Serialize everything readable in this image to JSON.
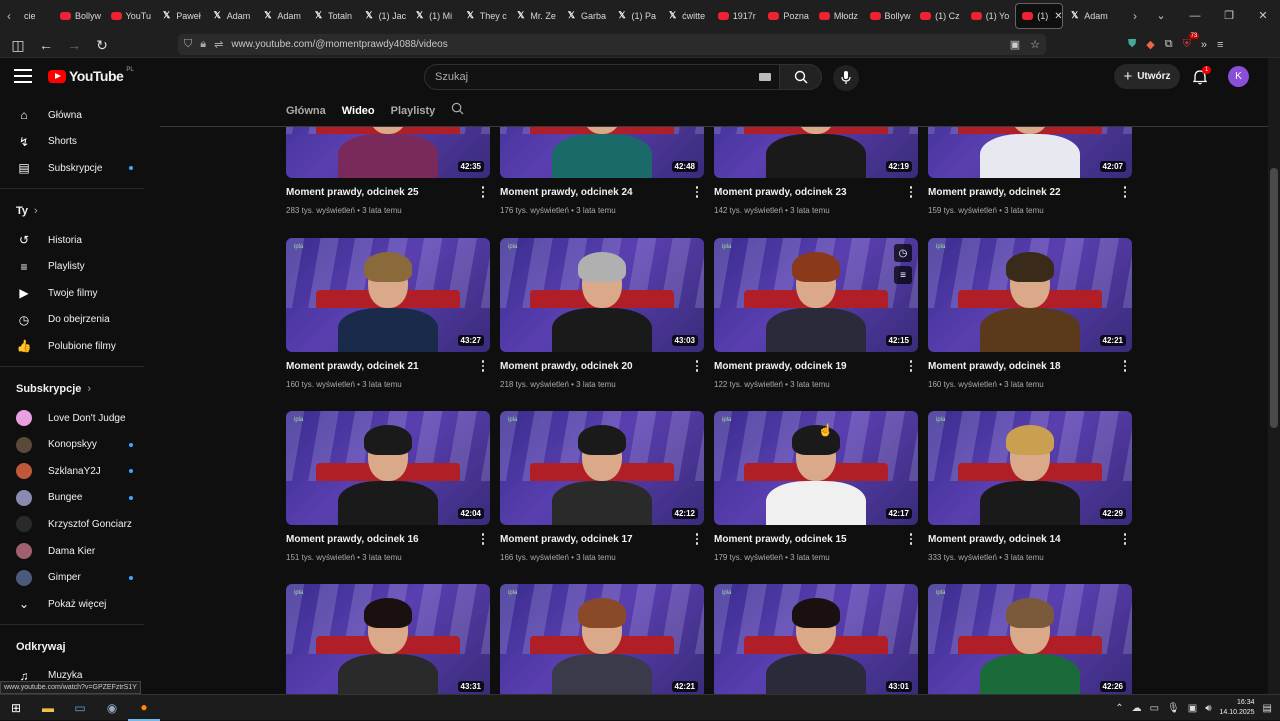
{
  "browser": {
    "tabs": [
      {
        "icon": "youtube",
        "label": "Bollyw"
      },
      {
        "icon": "youtube",
        "label": "YouTu"
      },
      {
        "icon": "x",
        "label": "Paweł"
      },
      {
        "icon": "x",
        "label": "Adam"
      },
      {
        "icon": "x",
        "label": "Adam"
      },
      {
        "icon": "x",
        "label": "Totaln"
      },
      {
        "icon": "x",
        "label": "(1) Jac"
      },
      {
        "icon": "x",
        "label": "(1) Mi"
      },
      {
        "icon": "x",
        "label": "They c"
      },
      {
        "icon": "x",
        "label": "Mr. Ze"
      },
      {
        "icon": "x",
        "label": "Garba"
      },
      {
        "icon": "x",
        "label": "(1) Pa"
      },
      {
        "icon": "x",
        "label": "ćwitte"
      },
      {
        "icon": "youtube",
        "label": "1917r"
      },
      {
        "icon": "youtube",
        "label": "Pozna"
      },
      {
        "icon": "youtube",
        "label": "Młodz"
      },
      {
        "icon": "youtube",
        "label": "Bollyw"
      },
      {
        "icon": "youtube",
        "label": "(1) Cz"
      },
      {
        "icon": "youtube",
        "label": "(1) Yo"
      },
      {
        "icon": "youtube",
        "label": "(1)",
        "active": true
      },
      {
        "icon": "x",
        "label": "Adam"
      }
    ],
    "first_tab_partial": "cie",
    "url": "www.youtube.com/@momentprawdy4088/videos",
    "ext_badge": "73",
    "status_url": "www.youtube.com/watch?v=GPZEFztrS1Y"
  },
  "youtube": {
    "logo_text": "YouTube",
    "logo_country": "PL",
    "search_placeholder": "Szukaj",
    "create_label": "Utwórz",
    "notif_count": "1",
    "avatar_letter": "K"
  },
  "sidebar": {
    "main": [
      {
        "label": "Główna",
        "icon": "home-icon",
        "glyph": "⌂"
      },
      {
        "label": "Shorts",
        "icon": "shorts-icon",
        "glyph": "↯"
      },
      {
        "label": "Subskrypcje",
        "icon": "subscriptions-icon",
        "glyph": "▤",
        "dot": true
      }
    ],
    "you_header": "Ty",
    "you": [
      {
        "label": "Historia",
        "icon": "history-icon",
        "glyph": "↺"
      },
      {
        "label": "Playlisty",
        "icon": "playlists-icon",
        "glyph": "≡"
      },
      {
        "label": "Twoje filmy",
        "icon": "your-videos-icon",
        "glyph": "▶"
      },
      {
        "label": "Do obejrzenia",
        "icon": "watch-later-icon",
        "glyph": "◷"
      },
      {
        "label": "Polubione filmy",
        "icon": "liked-icon",
        "glyph": "👍"
      }
    ],
    "subs_header": "Subskrypcje",
    "subs": [
      {
        "label": "Love Don't Judge",
        "color": "#e8a0e0",
        "dot": false
      },
      {
        "label": "Konopskyy",
        "color": "#5a4a3a",
        "dot": true
      },
      {
        "label": "SzklanaY2J",
        "color": "#c0583a",
        "dot": true
      },
      {
        "label": "Bungee",
        "color": "#8a8ab0",
        "dot": true
      },
      {
        "label": "Krzysztof Gonciarz",
        "color": "#2a2a2a",
        "dot": false
      },
      {
        "label": "Dama Kier",
        "color": "#a06070",
        "dot": false
      },
      {
        "label": "Gimper",
        "color": "#4a5a7a",
        "dot": true
      }
    ],
    "show_more": "Pokaż więcej",
    "explore_header": "Odkrywaj",
    "explore": [
      {
        "label": "Muzyka",
        "icon": "music-icon",
        "glyph": "♫"
      }
    ]
  },
  "channel_tabs": [
    "Główna",
    "Wideo",
    "Playlisty"
  ],
  "active_tab": "Wideo",
  "videos": [
    {
      "title": "Moment prawdy, odcinek 25",
      "meta": "283 tys. wyświetleń • 3 lata temu",
      "duration": "42:35",
      "shirt": "#7a2a5a",
      "hair": "#3a2a1a"
    },
    {
      "title": "Moment prawdy, odcinek 24",
      "meta": "176 tys. wyświetleń • 3 lata temu",
      "duration": "42:48",
      "shirt": "#1a6a6a",
      "hair": "#2a1a10"
    },
    {
      "title": "Moment prawdy, odcinek 23",
      "meta": "142 tys. wyświetleń • 3 lata temu",
      "duration": "42:19",
      "shirt": "#1a1a1a",
      "hair": "#1a1a1a"
    },
    {
      "title": "Moment prawdy, odcinek 22",
      "meta": "159 tys. wyświetleń • 3 lata temu",
      "duration": "42:07",
      "shirt": "#e8e8f0",
      "hair": "#3a2a1a"
    },
    {
      "title": "Moment prawdy, odcinek 21",
      "meta": "160 tys. wyświetleń • 3 lata temu",
      "duration": "43:27",
      "shirt": "#1a2a4a",
      "hair": "#8a6a3a"
    },
    {
      "title": "Moment prawdy, odcinek 20",
      "meta": "218 tys. wyświetleń • 3 lata temu",
      "duration": "43:03",
      "shirt": "#1a1a1a",
      "hair": "#b0b0b0"
    },
    {
      "title": "Moment prawdy, odcinek 19",
      "meta": "122 tys. wyświetleń • 3 lata temu",
      "duration": "42:15",
      "shirt": "#2a2a3a",
      "hair": "#8a3a1a",
      "hover": true
    },
    {
      "title": "Moment prawdy, odcinek 18",
      "meta": "160 tys. wyświetleń • 3 lata temu",
      "duration": "42:21",
      "shirt": "#5a3a1a",
      "hair": "#3a2a1a"
    },
    {
      "title": "Moment prawdy, odcinek 16",
      "meta": "151 tys. wyświetleń • 3 lata temu",
      "duration": "42:04",
      "shirt": "#1a1a1a",
      "hair": "#1a1a1a"
    },
    {
      "title": "Moment prawdy, odcinek 17",
      "meta": "166 tys. wyświetleń • 3 lata temu",
      "duration": "42:12",
      "shirt": "#2a2a2a",
      "hair": "#1a1a1a"
    },
    {
      "title": "Moment prawdy, odcinek 15",
      "meta": "179 tys. wyświetleń • 3 lata temu",
      "duration": "42:17",
      "shirt": "#f0f0f0",
      "hair": "#1a1a1a"
    },
    {
      "title": "Moment prawdy, odcinek 14",
      "meta": "333 tys. wyświetleń • 3 lata temu",
      "duration": "42:29",
      "shirt": "#1a1a1a",
      "hair": "#c8a050"
    },
    {
      "title": "",
      "meta": "",
      "duration": "43:31",
      "shirt": "#2a2a2a",
      "hair": "#1a1010"
    },
    {
      "title": "",
      "meta": "",
      "duration": "42:21",
      "shirt": "#3a3a4a",
      "hair": "#8a4a2a"
    },
    {
      "title": "",
      "meta": "",
      "duration": "43:01",
      "shirt": "#2a2a3a",
      "hair": "#1a1010"
    },
    {
      "title": "",
      "meta": "",
      "duration": "42:26",
      "shirt": "#1a6a3a",
      "hair": "#7a5a3a"
    }
  ],
  "taskbar": {
    "time": "16:34",
    "date": "14.10.2025"
  }
}
